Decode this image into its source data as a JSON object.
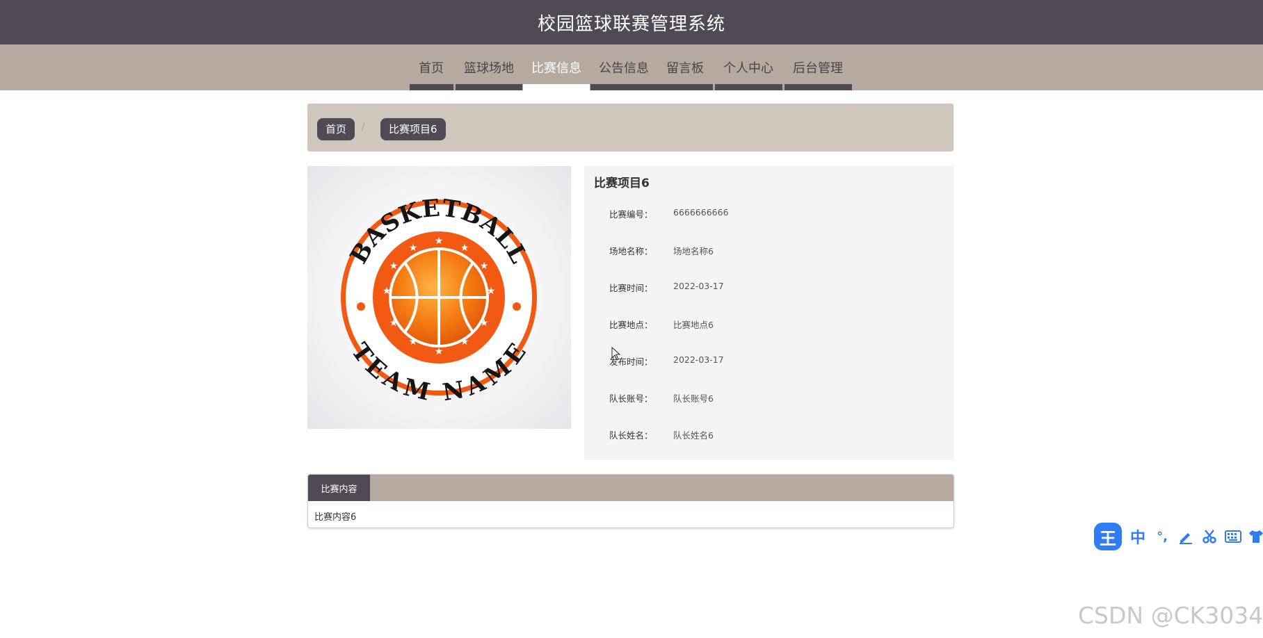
{
  "header": {
    "title": "校园篮球联赛管理系统"
  },
  "nav": {
    "items": [
      {
        "label": "首页"
      },
      {
        "label": "篮球场地"
      },
      {
        "label": "比赛信息"
      },
      {
        "label": "公告信息"
      },
      {
        "label": "留言板"
      },
      {
        "label": "个人中心"
      },
      {
        "label": "后台管理"
      }
    ],
    "active_index": 2
  },
  "breadcrumb": {
    "home": "首页",
    "separator": "/",
    "current": "比赛项目6"
  },
  "logo": {
    "top_text": "BASKETBALL",
    "bottom_text": "TEAM NAME"
  },
  "detail": {
    "title": "比赛项目6",
    "fields": [
      {
        "label": "比赛编号：",
        "value": "6666666666"
      },
      {
        "label": "场地名称：",
        "value": "场地名称6"
      },
      {
        "label": "比赛时间：",
        "value": "2022-03-17"
      },
      {
        "label": "比赛地点：",
        "value": "比赛地点6"
      },
      {
        "label": "发布时间：",
        "value": "2022-03-17"
      },
      {
        "label": "队长账号：",
        "value": "队长账号6"
      },
      {
        "label": "队长姓名：",
        "value": "队长姓名6"
      }
    ]
  },
  "tabs": {
    "active_label": "比赛内容",
    "content": "比赛内容6"
  },
  "ime_toolbar": {
    "logo": "王",
    "lang": "中",
    "punct": "°,"
  },
  "watermark": "CSDN @CK3034",
  "colors": {
    "header_bg": "#4f4a55",
    "nav_bg": "#b6aaa0",
    "breadcrumb_bg": "#d0c7bc",
    "ime_blue": "#2f7df6",
    "logo_orange": "#f25a14"
  }
}
